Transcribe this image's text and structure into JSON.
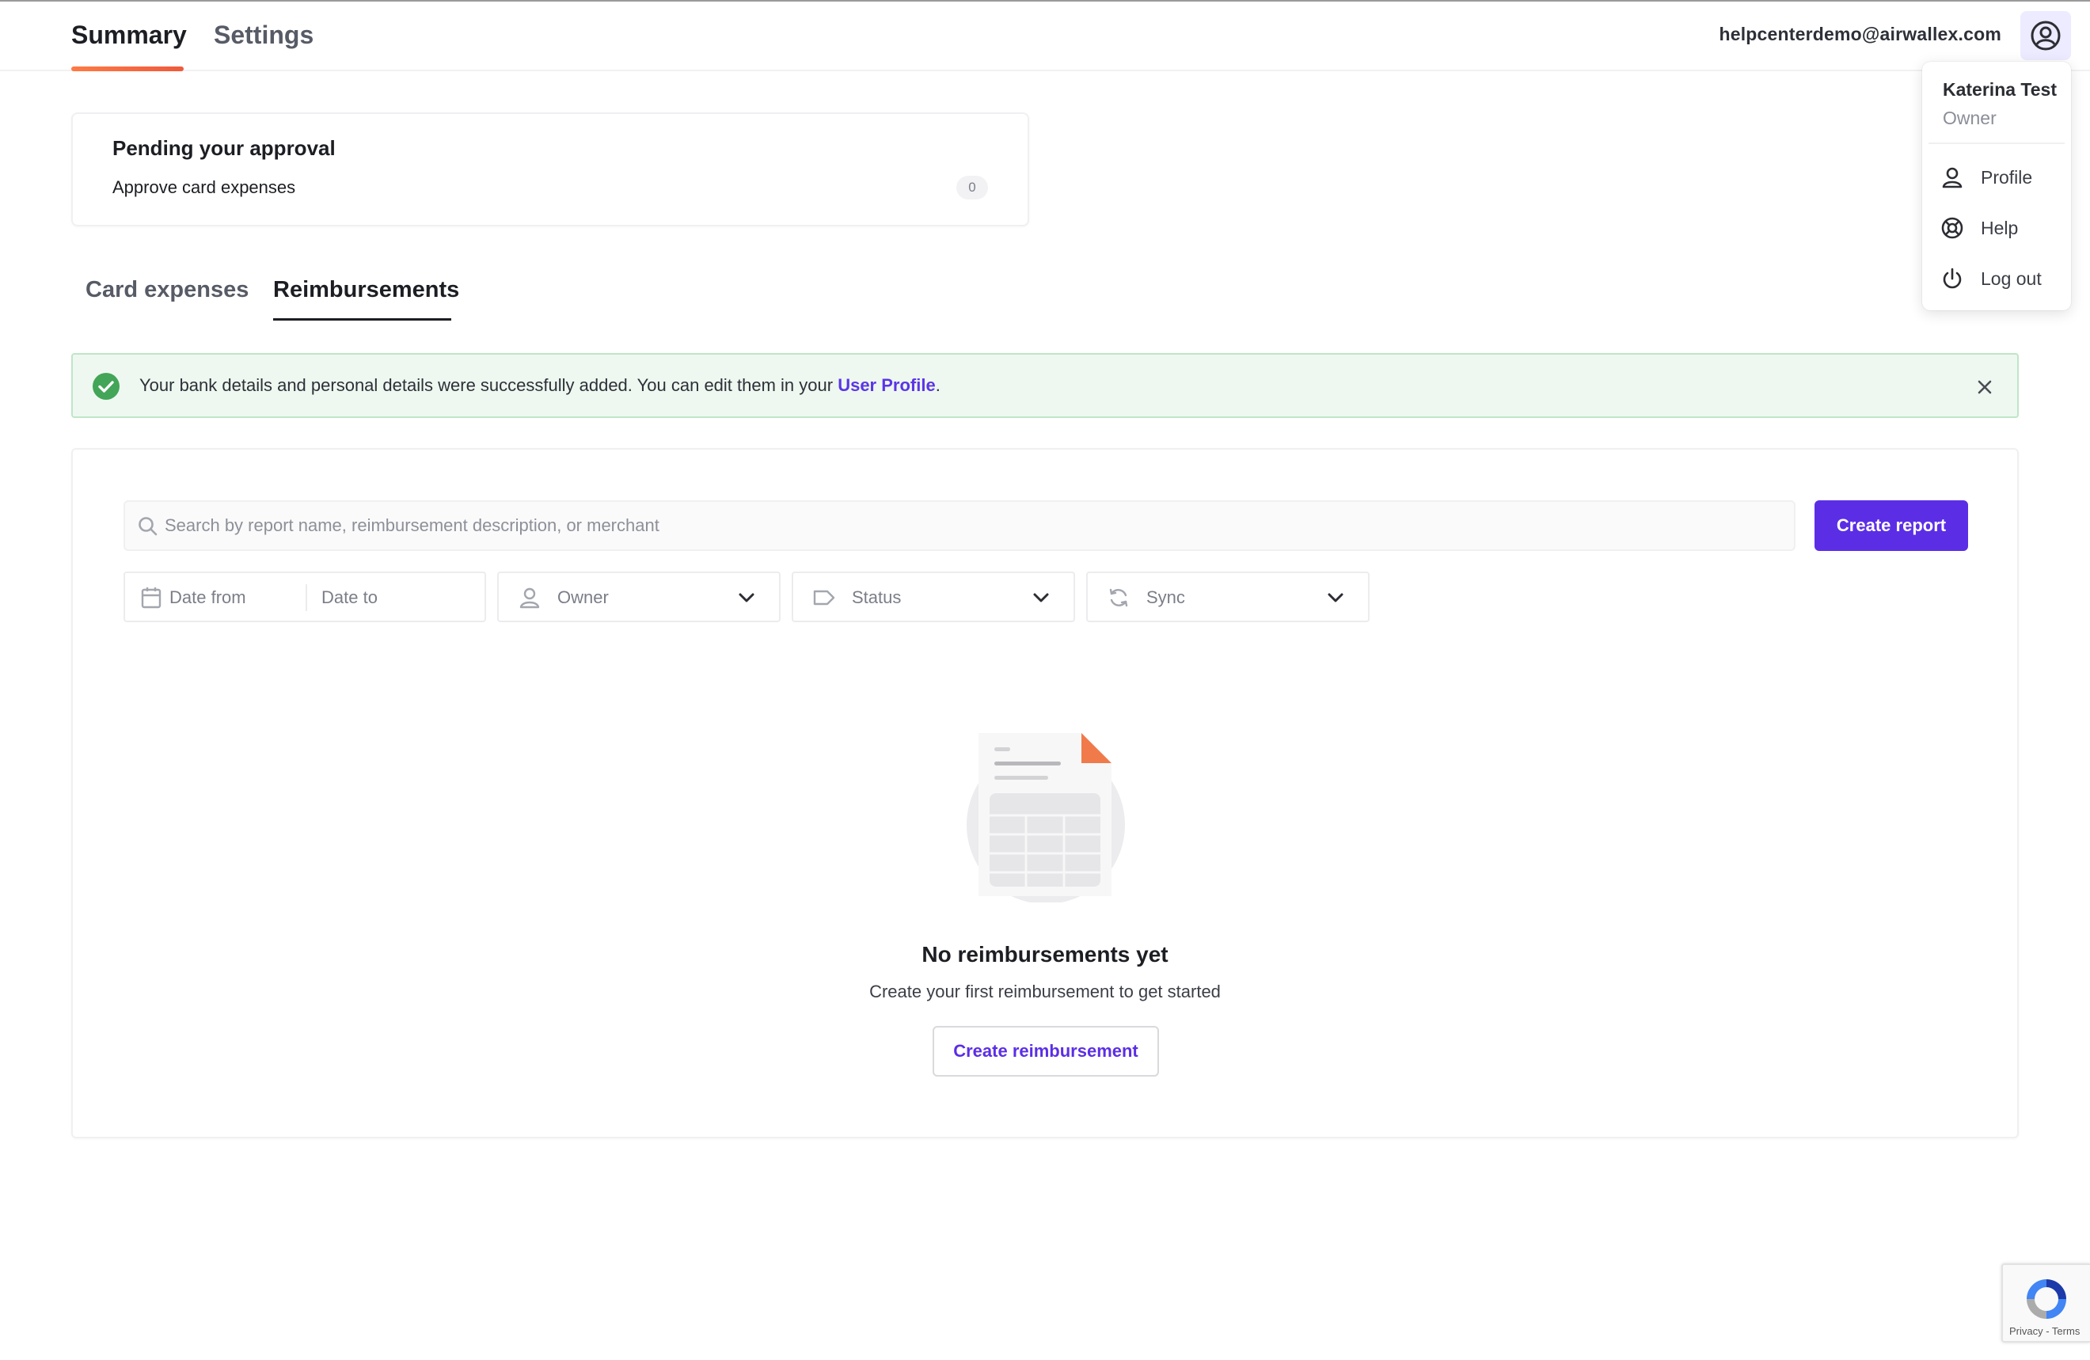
{
  "nav": {
    "tabs": [
      {
        "label": "Summary",
        "active": true
      },
      {
        "label": "Settings",
        "active": false
      }
    ],
    "user_email": "helpcenterdemo@airwallex.com"
  },
  "user_menu": {
    "name": "Katerina Test",
    "role": "Owner",
    "items": [
      {
        "label": "Profile",
        "icon": "person-icon"
      },
      {
        "label": "Help",
        "icon": "lifebuoy-icon"
      },
      {
        "label": "Log out",
        "icon": "power-icon"
      }
    ]
  },
  "pending": {
    "title": "Pending your approval",
    "row_label": "Approve card expenses",
    "count": "0"
  },
  "sub_tabs": [
    {
      "label": "Card expenses",
      "active": false
    },
    {
      "label": "Reimbursements",
      "active": true
    }
  ],
  "banner": {
    "text": "Your bank details and personal details were successfully added. You can edit them in your ",
    "link": "User Profile",
    "suffix": "."
  },
  "search": {
    "placeholder": "Search by report name, reimbursement description, or merchant",
    "value": ""
  },
  "create_report_label": "Create report",
  "filters": {
    "date_from": "Date from",
    "date_to": "Date to",
    "owner": "Owner",
    "status": "Status",
    "sync": "Sync"
  },
  "empty_state": {
    "title": "No reimbursements yet",
    "subtitle": "Create your first reimbursement to get started",
    "button": "Create reimbursement"
  },
  "recaptcha": {
    "links": "Privacy - Terms"
  },
  "colors": {
    "accent": "#5b2ee6",
    "success": "#43a557",
    "banner_bg": "#eef8f0",
    "nav_underline": "#ef5a3c",
    "illustration_corner": "#f07a4a"
  }
}
